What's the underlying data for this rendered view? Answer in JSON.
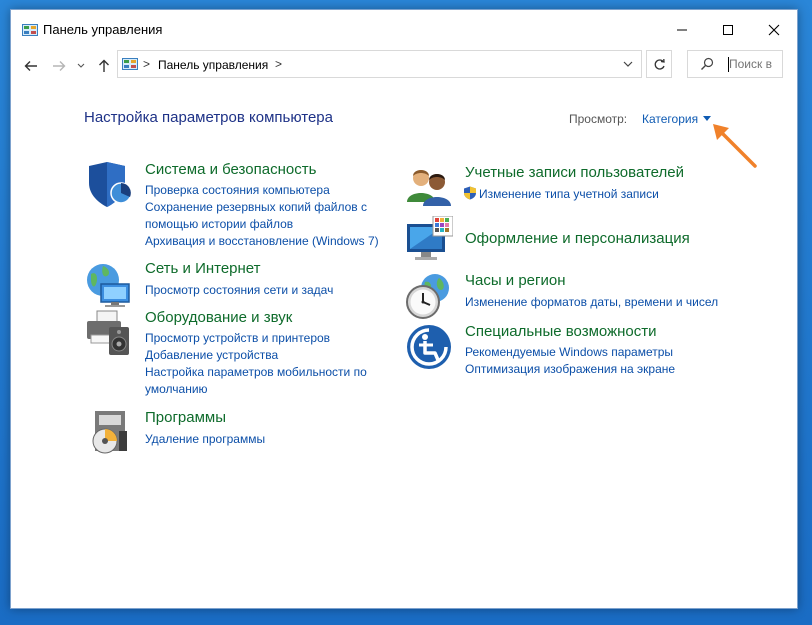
{
  "window": {
    "title": "Панель управления",
    "icons": {
      "app": "control-panel-icon",
      "minimize": "minimize-icon",
      "maximize": "maximize-icon",
      "close": "close-icon"
    }
  },
  "navbar": {
    "back_icon": "back-arrow-icon",
    "forward_icon": "forward-arrow-icon",
    "recent_icon": "chevron-down-icon",
    "up_icon": "up-arrow-icon",
    "address": {
      "separator": ">",
      "crumb": "Панель управления",
      "trailing_separator": ">"
    },
    "refresh_icon": "refresh-icon",
    "search": {
      "icon": "search-icon",
      "placeholder": "Поиск в"
    }
  },
  "main": {
    "heading": "Настройка параметров компьютера",
    "view": {
      "label": "Просмотр:",
      "value": "Категория"
    },
    "left_column": [
      {
        "icon": "security-shield-icon",
        "title": "Система и безопасность",
        "links": [
          "Проверка состояния компьютера",
          "Сохранение резервных копий файлов с помощью истории файлов",
          "Архивация и восстановление (Windows 7)"
        ]
      },
      {
        "icon": "network-globe-icon",
        "title": "Сеть и Интернет",
        "links": [
          "Просмотр состояния сети и задач"
        ]
      },
      {
        "icon": "printer-speaker-icon",
        "title": "Оборудование и звук",
        "links": [
          "Просмотр устройств и принтеров",
          "Добавление устройства",
          "Настройка параметров мобильности по умолчанию"
        ]
      },
      {
        "icon": "programs-disc-icon",
        "title": "Программы",
        "links": [
          "Удаление программы"
        ]
      }
    ],
    "right_column": [
      {
        "icon": "user-accounts-icon",
        "title": "Учетные записи пользователей",
        "links": [
          "Изменение типа учетной записи"
        ]
      },
      {
        "icon": "monitor-palette-icon",
        "title": "Оформление и персонализация",
        "links": []
      },
      {
        "icon": "clock-globe-icon",
        "title": "Часы и регион",
        "links": [
          "Изменение форматов даты, времени и чисел"
        ]
      },
      {
        "icon": "accessibility-icon",
        "title": "Специальные возможности",
        "links": [
          "Рекомендуемые Windows параметры",
          "Оптимизация изображения на экране"
        ]
      }
    ]
  },
  "annotation": {
    "icon": "orange-arrow-icon",
    "color": "#f0812a"
  },
  "colors": {
    "category_title": "#0e6b2b",
    "link": "#0c4fa8",
    "heading": "#1e3287",
    "desktop": "#1e73c9"
  }
}
